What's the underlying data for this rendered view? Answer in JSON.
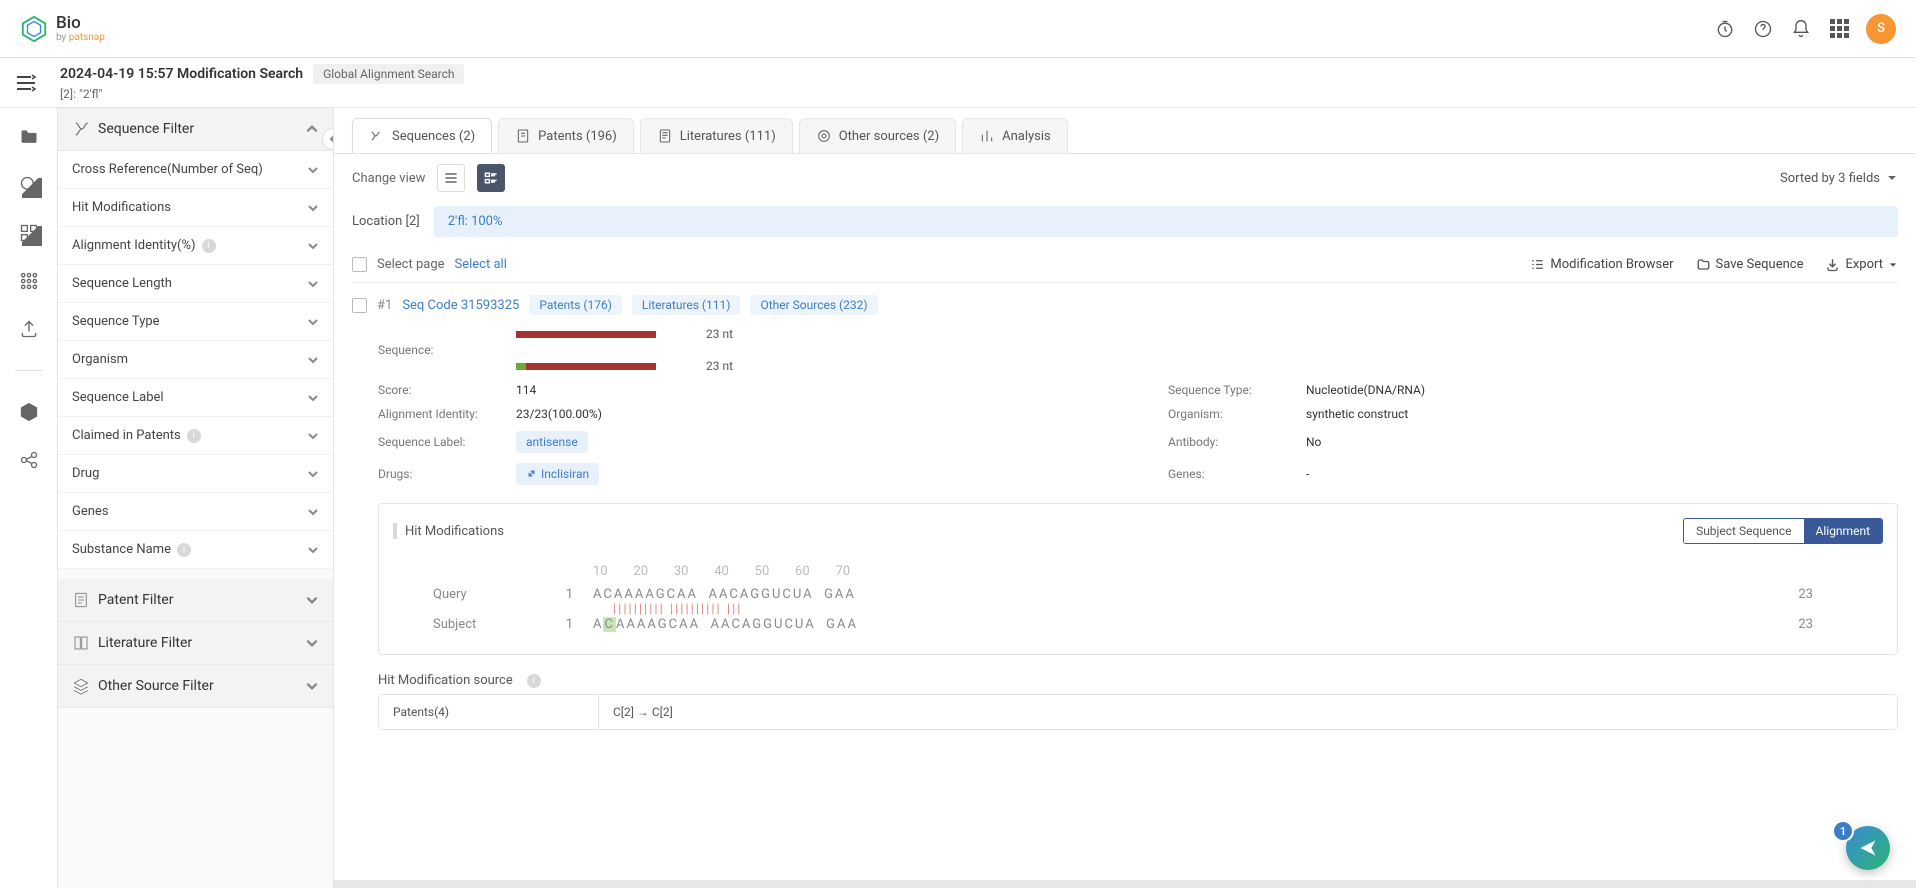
{
  "header": {
    "logo_title": "Bio",
    "logo_by": "by ",
    "logo_brand": "patsnap",
    "avatar_letter": "S"
  },
  "sub_header": {
    "title": "2024-04-19 15:57 Modification Search",
    "tag": "Global Alignment Search",
    "query": "[2]: \"2'fl\""
  },
  "filters": {
    "sequence_filter": "Sequence Filter",
    "items": [
      "Cross Reference(Number of Seq)",
      "Hit Modifications",
      "Alignment Identity(%)",
      "Sequence Length",
      "Sequence Type",
      "Organism",
      "Sequence Label",
      "Claimed in Patents",
      "Drug",
      "Genes",
      "Substance Name"
    ],
    "patent_filter": "Patent Filter",
    "literature_filter": "Literature Filter",
    "other_source_filter": "Other Source Filter"
  },
  "tabs": {
    "sequences": "Sequences (2)",
    "patents": "Patents (196)",
    "literatures": "Literatures (111)",
    "other": "Other sources (2)",
    "analysis": "Analysis"
  },
  "toolbar": {
    "change_view": "Change view",
    "sorted_by": "Sorted by 3 fields"
  },
  "location": {
    "label": "Location [2]",
    "chip": "2'fl: 100%"
  },
  "select": {
    "page": "Select page",
    "all": "Select all",
    "mod_browser": "Modification Browser",
    "save_seq": "Save Sequence",
    "export": "Export"
  },
  "result": {
    "index": "#1",
    "title": "Seq Code 31593325",
    "badges": {
      "patents": "Patents (176)",
      "literatures": "Literatures (111)",
      "others": "Other Sources (232)"
    },
    "seq_label": "Sequence:",
    "nt1": "23 nt",
    "nt2": "23 nt",
    "details": {
      "score_l": "Score:",
      "score_v": "114",
      "seqtype_l": "Sequence Type:",
      "seqtype_v": "Nucleotide(DNA/RNA)",
      "alignid_l": "Alignment Identity:",
      "alignid_v": "23/23(100.00%)",
      "organism_l": "Organism:",
      "organism_v": "synthetic construct",
      "seqlabel_l": "Sequence Label:",
      "seqlabel_v": "antisense",
      "antibody_l": "Antibody:",
      "antibody_v": "No",
      "drugs_l": "Drugs:",
      "drugs_v": "Inclisiran",
      "genes_l": "Genes:",
      "genes_v": "-"
    }
  },
  "hit_mod": {
    "title": "Hit Modifications",
    "toggle_subject": "Subject Sequence",
    "toggle_align": "Alignment",
    "ruler": "10        20        30        40        50        60        70",
    "query_name": "Query",
    "subject_name": "Subject",
    "pos_start": "1",
    "seq1": "ACAAAAGCAA",
    "seq2": "AACAGGUCUA",
    "seq3": "GAA",
    "match": "||||||||||  |||||||||| |||",
    "pos_end": "23"
  },
  "hit_source": {
    "label": "Hit Modification source",
    "patents_cell": "Patents(4)",
    "mod_cell": "C[2] → C[2]"
  },
  "fab": {
    "badge": "1"
  }
}
